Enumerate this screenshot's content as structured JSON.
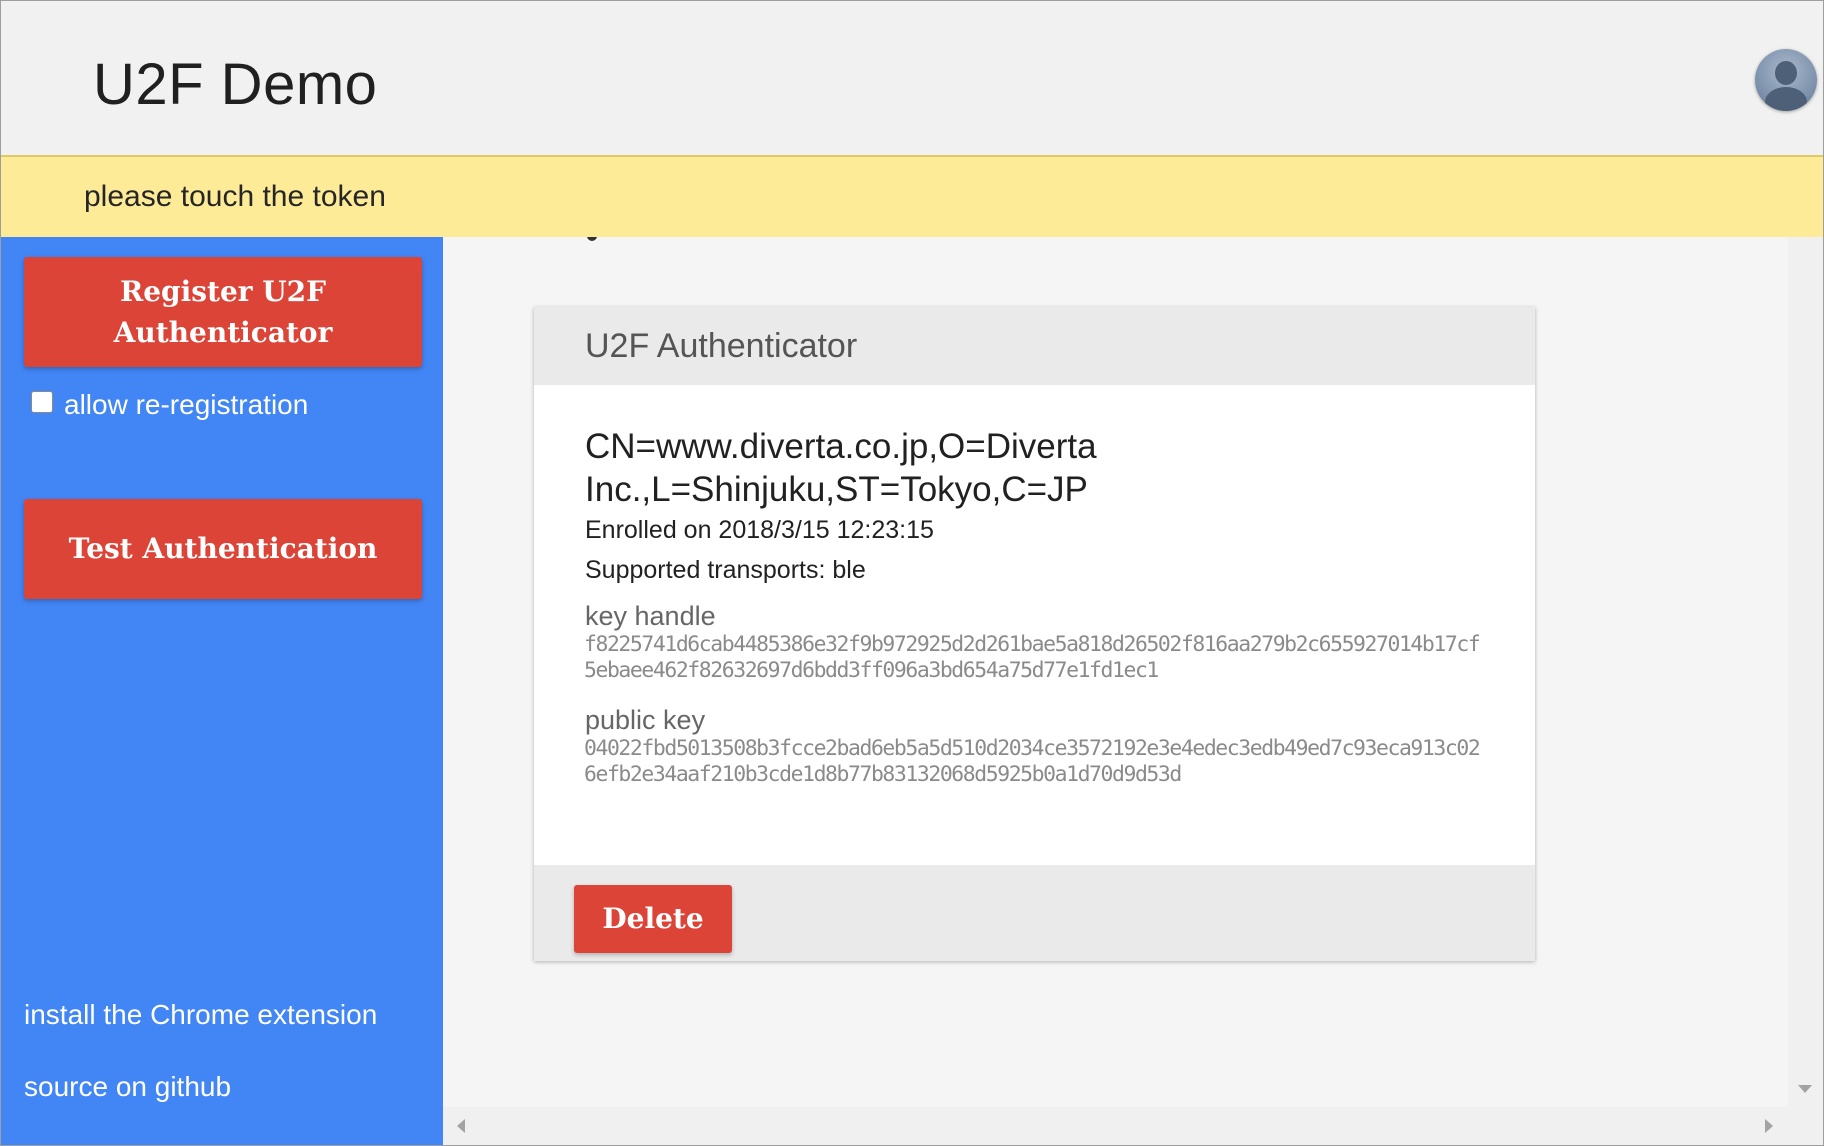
{
  "header": {
    "title": "U2F Demo",
    "avatar_icon": "user-avatar-icon"
  },
  "toast": {
    "message": "please touch the token",
    "background": "#feeb98"
  },
  "sidebar": {
    "background": "#4285f4",
    "register_button": {
      "line1": "Register U2F",
      "line2": "Authenticator"
    },
    "allow_reregistration": {
      "label": "allow re-registration",
      "checked": false
    },
    "test_button": "Test Authentication",
    "links": {
      "chrome_extension": "install the Chrome extension",
      "github": "source on github"
    }
  },
  "card": {
    "title": "U2F Authenticator",
    "subject": "CN=www.diverta.co.jp,O=Diverta Inc.,L=Shinjuku,ST=Tokyo,C=JP",
    "enrolled": "Enrolled on 2018/3/15 12:23:15",
    "transports": "Supported transports: ble",
    "key_handle_label": "key handle",
    "key_handle": "f8225741d6cab4485386e32f9b972925d2d261bae5a818d26502f816aa279b2c655927014b17cf5ebaee462f82632697d6bdd3ff096a3bd654a75d77e1fd1ec1",
    "public_key_label": "public key",
    "public_key": "04022fbd5013508b3fcce2bad6eb5a5d510d2034ce3572192e3e4edec3edb49ed7c93eca913c026efb2e34aaf210b3cde1d8b77b83132068d5925b0a1d70d9d53d",
    "delete_button": "Delete"
  },
  "colors": {
    "accent_red": "#db4437",
    "sidebar_blue": "#4285f4",
    "toast_yellow": "#feeb98"
  }
}
